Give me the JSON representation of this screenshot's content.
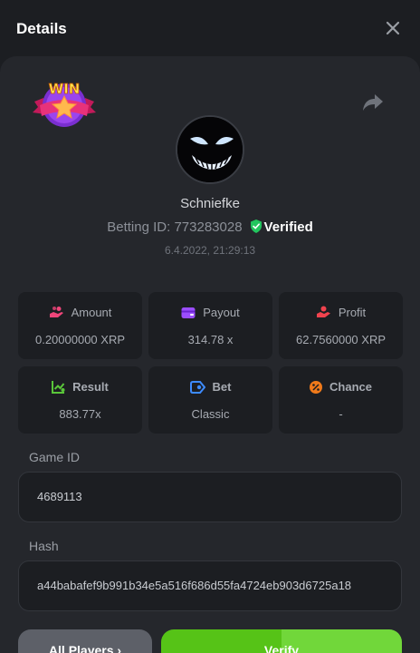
{
  "header": {
    "title": "Details"
  },
  "user": {
    "name": "Schniefke",
    "betting_id_label": "Betting ID:",
    "betting_id": "773283028",
    "verified_label": "Verified",
    "date": "6.4.2022, 21:29:13",
    "badge_text": "WIN"
  },
  "stats": [
    {
      "label": "Amount",
      "value": "0.20000000 XRP",
      "icon": "hand-coins-icon",
      "color": "#f0457a"
    },
    {
      "label": "Payout",
      "value": "314.78 x",
      "icon": "wallet-icon",
      "color": "#9b4dff"
    },
    {
      "label": "Profit",
      "value": "62.7560000 XRP",
      "icon": "hand-receive-icon",
      "color": "#f0434e"
    },
    {
      "label": "Result",
      "value": "883.77x",
      "icon": "chart-up-icon",
      "color": "#5ac63a"
    },
    {
      "label": "Bet",
      "value": "Classic",
      "icon": "tag-icon",
      "color": "#3d8bff"
    },
    {
      "label": "Chance",
      "value": "-",
      "icon": "percent-icon",
      "color": "#f07a1a"
    }
  ],
  "game": {
    "label": "Game ID",
    "value": "4689113"
  },
  "hash": {
    "label": "Hash",
    "value": "a44babafef9b991b34e5a516f686d55fa4724eb903d6725a18"
  },
  "buttons": {
    "all_players": "All Players ›",
    "verify": "Verify"
  },
  "colors": {
    "verify_green": "#56c317",
    "verified_badge": "#22c55e"
  }
}
